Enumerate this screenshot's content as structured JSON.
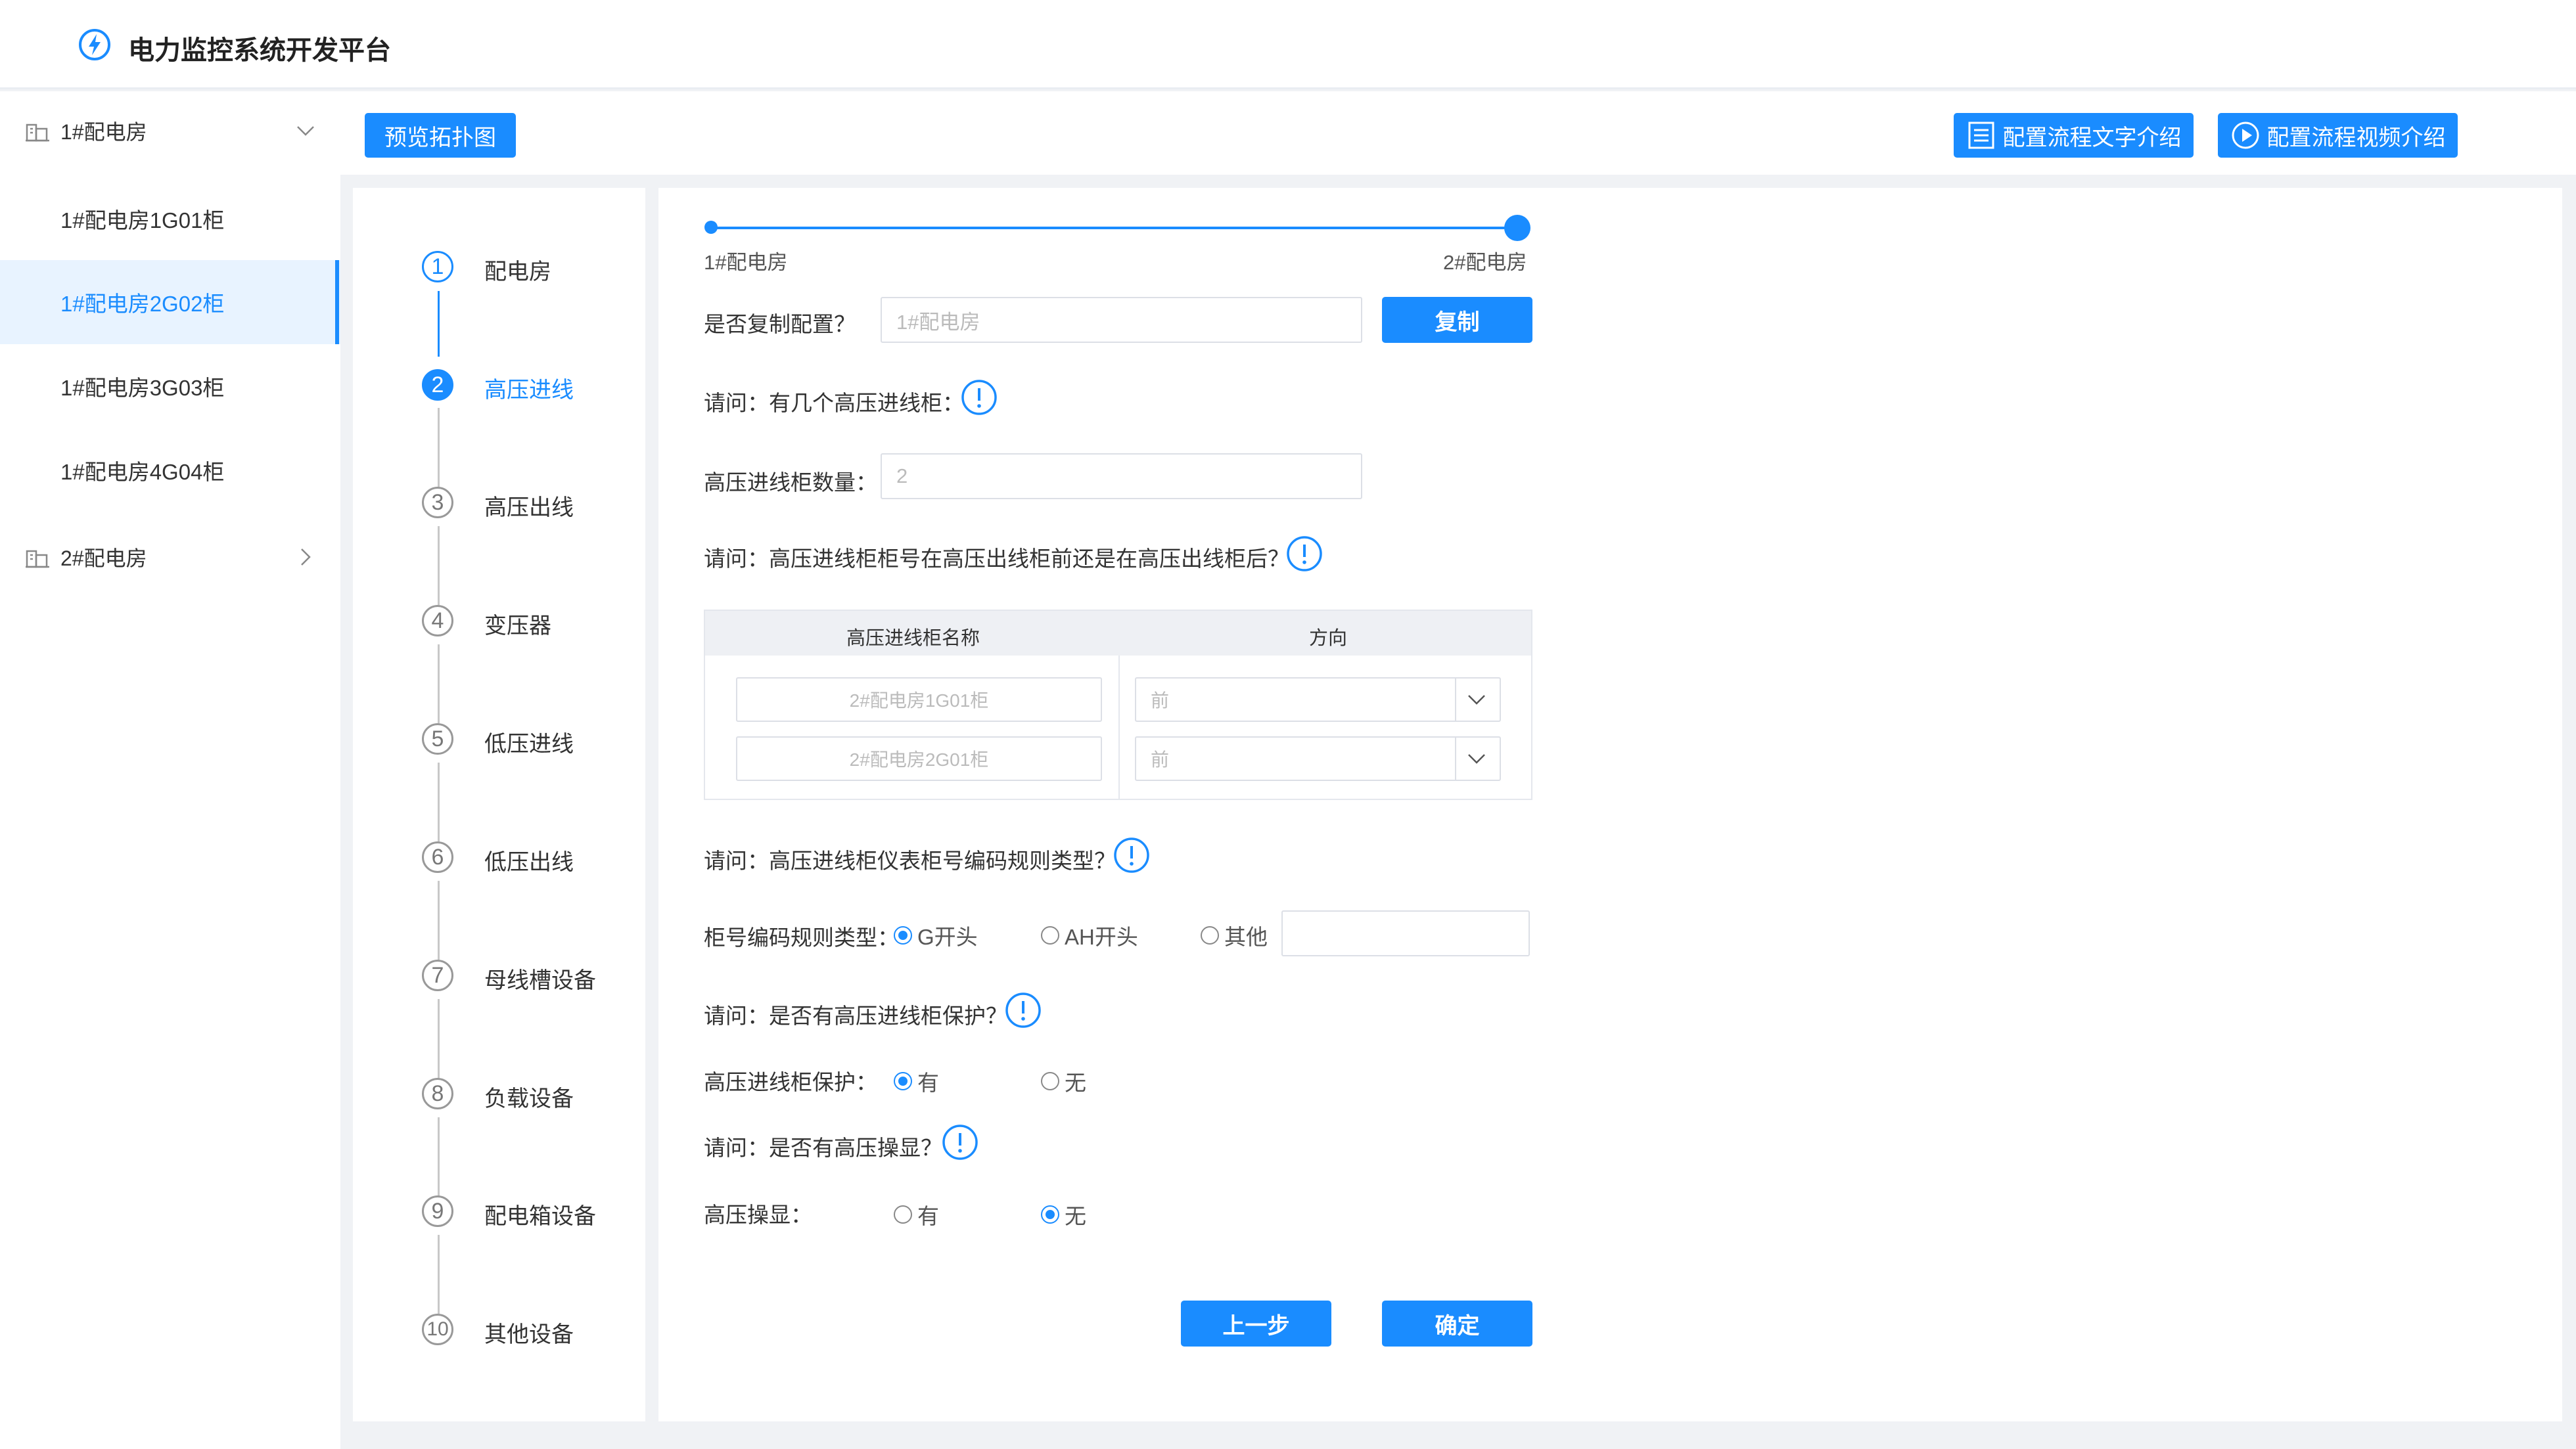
{
  "app": {
    "title": "电力监控系统开发平台"
  },
  "sidebar": {
    "group1": "1#配电房",
    "items": [
      "1#配电房1G01柜",
      "1#配电房2G02柜",
      "1#配电房3G03柜",
      "1#配电房4G04柜"
    ],
    "group2": "2#配电房"
  },
  "toolbar": {
    "preview": "预览拓扑图",
    "text_intro": "配置流程文字介绍",
    "video_intro": "配置流程视频介绍"
  },
  "steps": [
    {
      "num": "1",
      "label": "配电房"
    },
    {
      "num": "2",
      "label": "高压进线"
    },
    {
      "num": "3",
      "label": "高压出线"
    },
    {
      "num": "4",
      "label": "变压器"
    },
    {
      "num": "5",
      "label": "低压进线"
    },
    {
      "num": "6",
      "label": "低压出线"
    },
    {
      "num": "7",
      "label": "母线槽设备"
    },
    {
      "num": "8",
      "label": "负载设备"
    },
    {
      "num": "9",
      "label": "配电箱设备"
    },
    {
      "num": "10",
      "label": "其他设备"
    }
  ],
  "form": {
    "slider": {
      "left": "1#配电房",
      "right": "2#配电房",
      "value_fraction": 1.0
    },
    "copy_q": "是否复制配置？",
    "copy_placeholder": "1#配电房",
    "copy_btn": "复制",
    "q1": "请问：有几个高压进线柜：",
    "count_label": "高压进线柜数量：",
    "count_value": "2",
    "q2": "请问：高压进线柜柜号在高压出线柜前还是在高压出线柜后？",
    "table": {
      "col1": "高压进线柜名称",
      "col2": "方向",
      "rows": [
        {
          "name": "2#配电房1G01柜",
          "dir": "前"
        },
        {
          "name": "2#配电房2G01柜",
          "dir": "前"
        }
      ]
    },
    "q3": "请问：高压进线柜仪表柜号编码规则类型？",
    "rule_label": "柜号编码规则类型：",
    "rule_opts": [
      "G开头",
      "AH开头",
      "其他"
    ],
    "q4": "请问：是否有高压进线柜保护？",
    "protect_label": "高压进线柜保护：",
    "yes": "有",
    "no": "无",
    "q5": "请问：是否有高压操显？",
    "display_label": "高压操显：",
    "prev_btn": "上一步",
    "ok_btn": "确定"
  },
  "colors": {
    "accent": "#1a8cff"
  }
}
